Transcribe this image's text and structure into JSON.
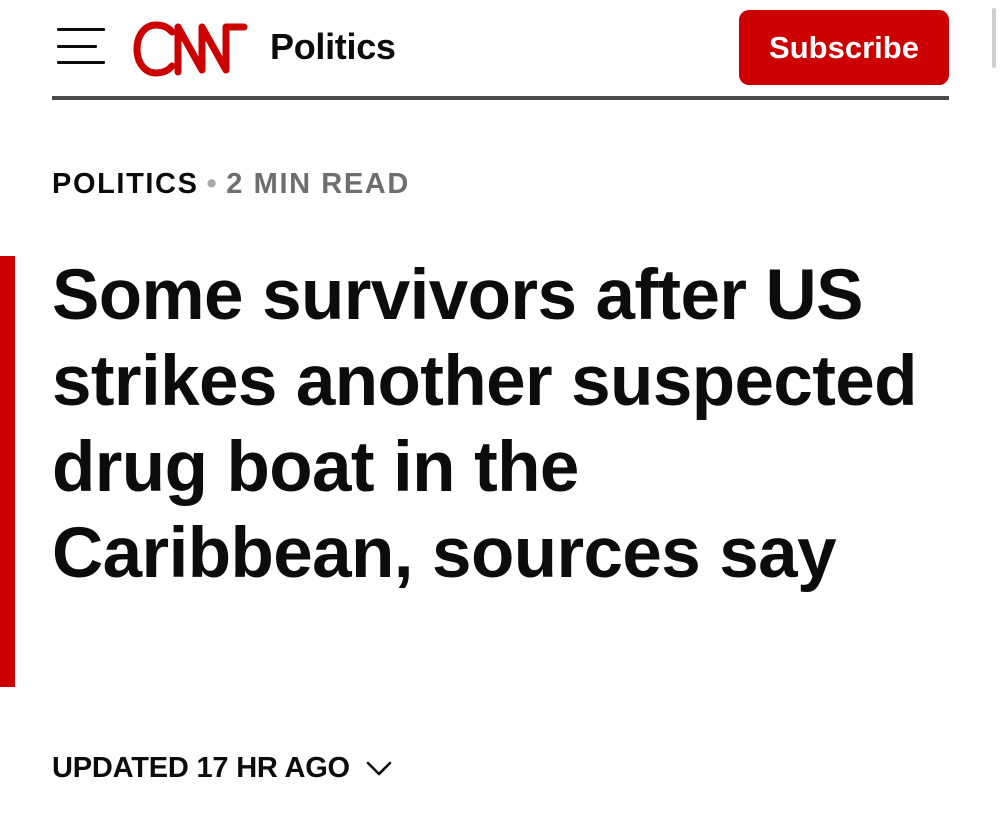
{
  "header": {
    "menu_icon": "hamburger-menu-icon",
    "logo_text": "CNN",
    "logo_color": "#cc0000",
    "section": "Politics",
    "subscribe_label": "Subscribe",
    "subscribe_color": "#cc0000"
  },
  "article": {
    "section_label": "POLITICS",
    "separator": "•",
    "read_time": "2 MIN READ",
    "headline": "Some survivors after US strikes another suspected drug boat in the Caribbean, sources say",
    "updated": "UPDATED 17 HR AGO",
    "updated_icon": "chevron-down-icon",
    "accent_color": "#cc0000"
  }
}
